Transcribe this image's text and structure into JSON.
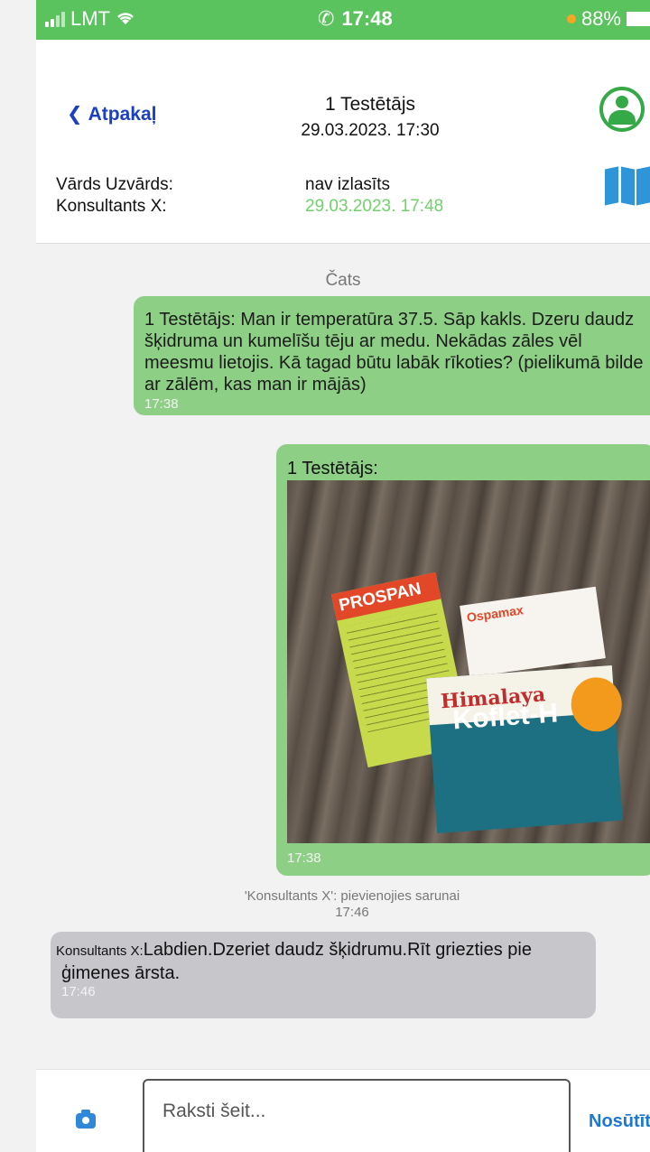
{
  "status_bar": {
    "carrier": "LMT",
    "time": "17:48",
    "battery": "88%"
  },
  "header": {
    "back_label": "Atpakaļ",
    "title": "1 Testētājs",
    "date": "29.03.2023. 17:30",
    "user_label": "Vārds Uzvārds:",
    "user_value": "nav izlasīts",
    "consultant_label": "Konsultants X:",
    "consultant_value": "29.03.2023. 17:48",
    "icons": [
      "doctor-icon",
      "map-icon"
    ]
  },
  "chat": {
    "heading": "Čats",
    "messages": [
      {
        "text": "1 Testētājs: Man ir temperatūra 37.5. Sāp kakls. Dzeru daudz šķidruma un kumelīšu tēju ar medu. Nekādas zāles vēl meesmu lietojis. Kā tagad būtu labāk rīkoties? (pielikumā bilde ar zālēm, kas man ir mājās)",
        "time": "17:38"
      },
      {
        "sender": "1 Testētājs:",
        "time": "17:38",
        "photo": {
          "box1": "PROSPAN",
          "box2": "Ospamax",
          "box3_brand": "Himalaya",
          "box3_name": "Koflet-H"
        }
      }
    ],
    "system_note": "'Konsultants X': pievienojies sarunai",
    "system_time": "17:46",
    "reply": {
      "sender": "Konsultants X:",
      "text": "Labdien.Dzeriet daudz šķidrumu.Rīt griezties pie",
      "text2": "ģimenes ārsta.",
      "time": "17:46"
    }
  },
  "input_bar": {
    "placeholder": "Raksti šeit...",
    "send_label": "Nosūtīt"
  },
  "colors": {
    "status_green": "#5bc35d",
    "bubble_green": "#8ecf86",
    "bubble_grey": "#c7c7cb",
    "link_blue": "#1a3fc4"
  }
}
